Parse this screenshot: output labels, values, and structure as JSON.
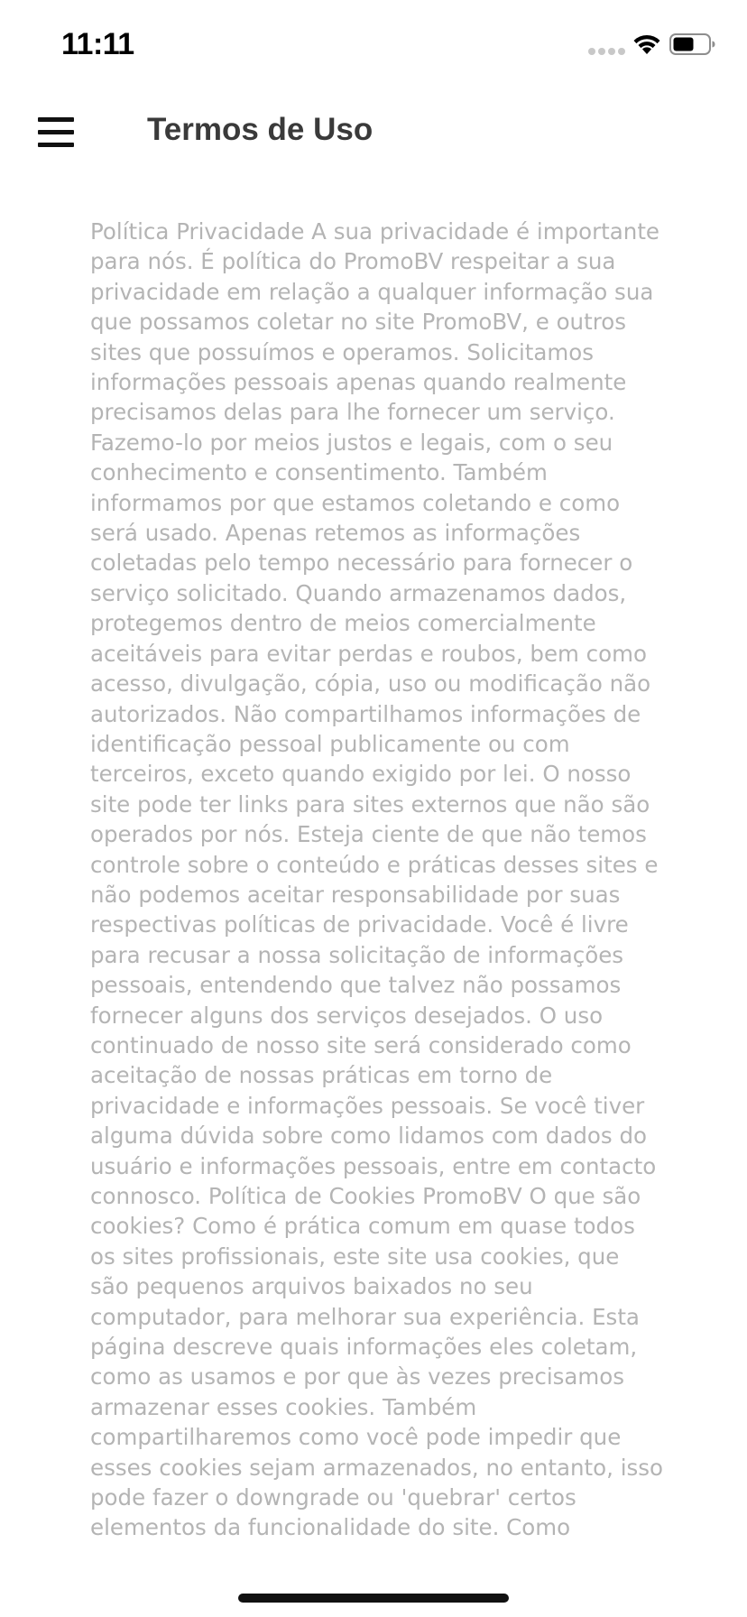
{
  "status_bar": {
    "time": "11:11",
    "icons": [
      "signal-dots-icon",
      "wifi-icon",
      "battery-icon"
    ]
  },
  "header": {
    "title": "Termos de Uso",
    "menu_icon": "hamburger-menu-icon"
  },
  "content": {
    "text": "Política Privacidade A sua privacidade é importante para nós. É política do PromoBV respeitar a sua privacidade em relação a qualquer informação sua que possamos coletar no site PromoBV, e outros sites que possuímos e operamos. Solicitamos informações pessoais apenas quando realmente precisamos delas para lhe fornecer um serviço. Fazemo-lo por meios justos e legais, com o seu conhecimento e consentimento. Também informamos por que estamos coletando e como será usado. Apenas retemos as informações coletadas pelo tempo necessário para fornecer o serviço solicitado. Quando armazenamos dados, protegemos dentro de meios comercialmente aceitáveis para evitar perdas e roubos, bem como acesso, divulgação, cópia, uso ou modificação não autorizados. Não compartilhamos informações de identificação pessoal publicamente ou com terceiros, exceto quando exigido por lei. O nosso site pode ter links para sites externos que não são operados por nós. Esteja ciente de que não temos controle sobre o conteúdo e práticas desses sites e não podemos aceitar responsabilidade por suas respectivas políticas de privacidade. Você é livre para recusar a nossa solicitação de informações pessoais, entendendo que talvez não possamos fornecer alguns dos serviços desejados. O uso continuado de nosso site será considerado como aceitação de nossas práticas em torno de privacidade e informações pessoais. Se você tiver alguma dúvida sobre como lidamos com dados do usuário e informações pessoais, entre em contacto connosco. Política de Cookies PromoBV O que são cookies? Como é prática comum em quase todos os sites profissionais, este site usa cookies, que são pequenos arquivos baixados no seu computador, para melhorar sua experiência. Esta página descreve quais informações eles coletam, como as usamos e por que às vezes precisamos armazenar esses cookies. Também compartilharemos como você pode impedir que esses cookies sejam armazenados, no entanto, isso pode fazer o downgrade ou 'quebrar' certos elementos da funcionalidade do site. Como"
  },
  "colors": {
    "text": "#b4b4b4",
    "title": "#3a3a3a",
    "background": "#ffffff"
  }
}
